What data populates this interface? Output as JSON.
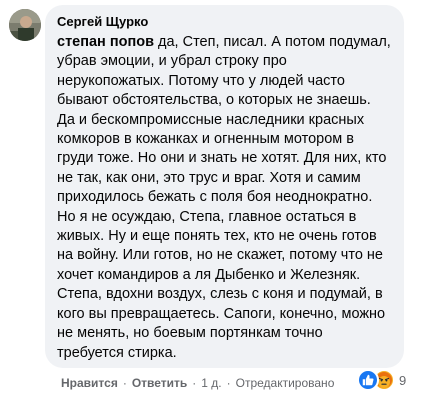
{
  "comment": {
    "author": "Сергей Щурко",
    "mention": "степан попов",
    "body": " да, Степ, писал. А потом подумал, убрав эмоции, и убрал строку про нерукопожатых. Потому что у людей часто бывают обстоятельства, о которых не знаешь. Да и бескомпромиссные наследники красных комкоров в кожанках и огненным мотором в груди тоже. Но они и знать не хотят. Для них, кто не так, как они, это трус и враг. Хотя и самим приходилось бежать с поля боя неоднократно. Но я не осуждаю, Степа, главное остаться в живых. Ну и еще понять тех, кто не очень готов на войну. Или готов, но не скажет, потому что не хочет командиров а ля Дыбенко и Железняк. Степа, вдохни воздух, слезь с коня и подумай, в кого вы превращаетесь. Сапоги, конечно, можно не менять, но боевым портянкам точно требуется стирка."
  },
  "actions": {
    "like": "Нравится",
    "reply": "Ответить",
    "time": "1 д.",
    "edited": "Отредактировано",
    "separator": "·"
  },
  "reactions": {
    "icons": [
      "like-icon",
      "angry-icon"
    ],
    "count": "9",
    "colors": {
      "like": "#1877f2",
      "angry": "#f7b125"
    }
  }
}
